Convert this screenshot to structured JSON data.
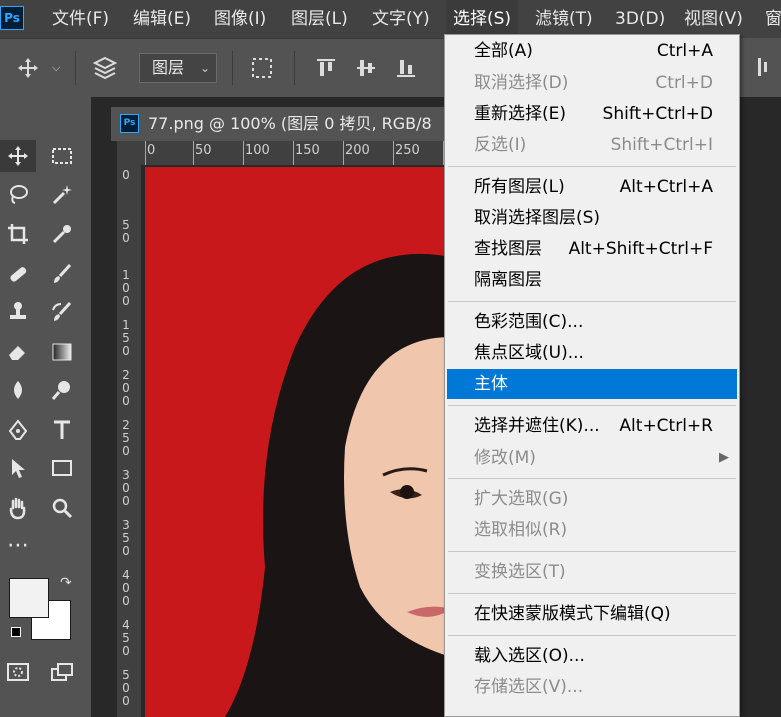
{
  "app": {
    "logo_text": "Ps"
  },
  "menubar": {
    "items": [
      {
        "label": "文件(F)"
      },
      {
        "label": "编辑(E)"
      },
      {
        "label": "图像(I)"
      },
      {
        "label": "图层(L)"
      },
      {
        "label": "文字(Y)"
      },
      {
        "label": "选择(S)"
      },
      {
        "label": "滤镜(T)"
      },
      {
        "label": "3D(D)"
      },
      {
        "label": "视图(V)"
      },
      {
        "label": "窗"
      }
    ]
  },
  "options_bar": {
    "layer_select_value": "图层",
    "icons": [
      "move-icon",
      "chevron-down-icon",
      "layers-icon",
      "transform-controls-icon",
      "align-top-icon",
      "align-vcenter-icon",
      "align-bottom-icon",
      "distribute-icon"
    ]
  },
  "document": {
    "tab_title": "77.png @ 100% (图层 0 拷贝, RGB/8",
    "tab_icon_text": "Ps",
    "ruler_top_labels": [
      "0",
      "50",
      "100",
      "150",
      "200",
      "250"
    ],
    "ruler_left_labels": [
      "0",
      "5 0",
      "1 0 0",
      "1 5 0",
      "2 0 0",
      "2 5 0",
      "3 0 0",
      "3 5 0",
      "4 0 0",
      "4 5 0",
      "5 0 0"
    ]
  },
  "tools": [
    "move-tool-icon",
    "marquee-tool-icon",
    "lasso-tool-icon",
    "magic-wand-tool-icon",
    "crop-tool-icon",
    "eyedropper-tool-icon",
    "healing-brush-tool-icon",
    "brush-tool-icon",
    "clone-stamp-tool-icon",
    "history-brush-tool-icon",
    "eraser-tool-icon",
    "gradient-tool-icon",
    "blur-tool-icon",
    "dodge-tool-icon",
    "pen-tool-icon",
    "type-tool-icon",
    "path-selection-tool-icon",
    "rectangle-tool-icon",
    "hand-tool-icon",
    "zoom-tool-icon",
    "more-tools-icon"
  ],
  "colors": {
    "foreground": "#f2f2f2",
    "background": "#ffffff",
    "canvas_bg": "#c8181c",
    "highlight": "#0078d7"
  },
  "select_menu": {
    "items": [
      {
        "label": "全部(A)",
        "shortcut": "Ctrl+A",
        "disabled": false
      },
      {
        "label": "取消选择(D)",
        "shortcut": "Ctrl+D",
        "disabled": true
      },
      {
        "label": "重新选择(E)",
        "shortcut": "Shift+Ctrl+D",
        "disabled": false
      },
      {
        "label": "反选(I)",
        "shortcut": "Shift+Ctrl+I",
        "disabled": true
      },
      {
        "label": "所有图层(L)",
        "shortcut": "Alt+Ctrl+A",
        "disabled": false
      },
      {
        "label": "取消选择图层(S)",
        "shortcut": "",
        "disabled": false
      },
      {
        "label": "查找图层",
        "shortcut": "Alt+Shift+Ctrl+F",
        "disabled": false
      },
      {
        "label": "隔离图层",
        "shortcut": "",
        "disabled": false
      },
      {
        "label": "色彩范围(C)...",
        "shortcut": "",
        "disabled": false
      },
      {
        "label": "焦点区域(U)...",
        "shortcut": "",
        "disabled": false
      },
      {
        "label": "主体",
        "shortcut": "",
        "disabled": false,
        "highlighted": true
      },
      {
        "label": "选择并遮住(K)...",
        "shortcut": "Alt+Ctrl+R",
        "disabled": false
      },
      {
        "label": "修改(M)",
        "shortcut": "",
        "disabled": true,
        "submenu": true
      },
      {
        "label": "扩大选取(G)",
        "shortcut": "",
        "disabled": true
      },
      {
        "label": "选取相似(R)",
        "shortcut": "",
        "disabled": true
      },
      {
        "label": "变换选区(T)",
        "shortcut": "",
        "disabled": true
      },
      {
        "label": "在快速蒙版模式下编辑(Q)",
        "shortcut": "",
        "disabled": false
      },
      {
        "label": "载入选区(O)...",
        "shortcut": "",
        "disabled": false
      },
      {
        "label": "存储选区(V)...",
        "shortcut": "",
        "disabled": true
      }
    ]
  }
}
